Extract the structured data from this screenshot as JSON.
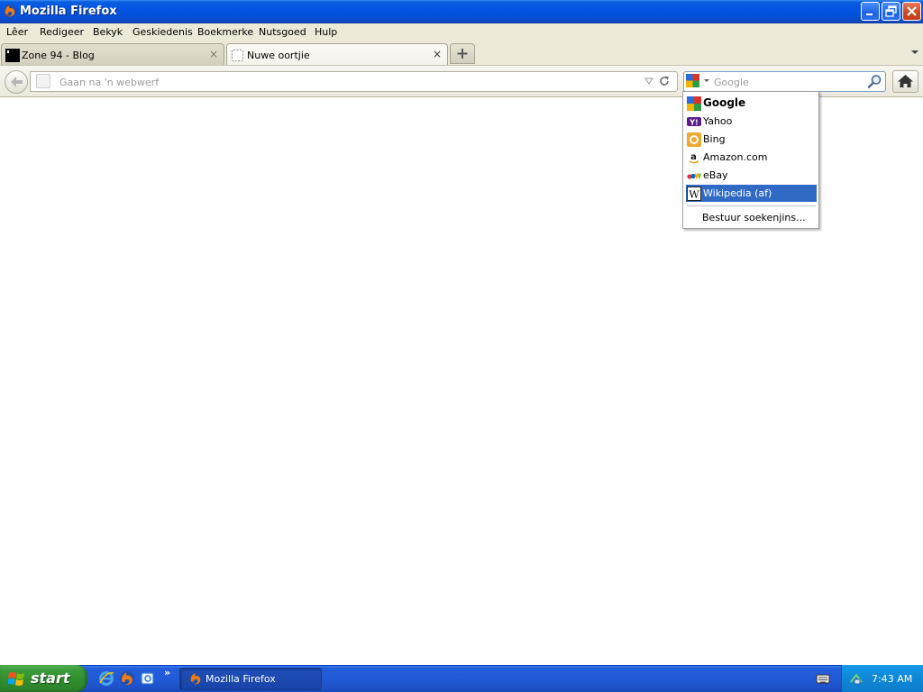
{
  "window": {
    "title": "Mozilla Firefox",
    "icon": "firefox-icon",
    "controls": [
      "minimize-icon",
      "restore-icon",
      "close-icon"
    ]
  },
  "menubar": {
    "items": [
      {
        "label": "Lêer"
      },
      {
        "label": "Redigeer"
      },
      {
        "label": "Bekyk"
      },
      {
        "label": "Geskiedenis"
      },
      {
        "label": "Boekmerke"
      },
      {
        "label": "Nutsgoed"
      },
      {
        "label": "Hulp"
      }
    ]
  },
  "tabs": [
    {
      "label": "Zone 94 - Blog",
      "favicon": "zone94-favicon",
      "active": false
    },
    {
      "label": "Nuwe oortjie",
      "favicon": "blank-page-icon",
      "active": true
    }
  ],
  "tab_close_glyph": "×",
  "navbar": {
    "url_placeholder": "Gaan na 'n webwerf",
    "url_value": "",
    "search_placeholder": "Google",
    "search_value": "",
    "current_engine": "google-icon"
  },
  "search_popup": {
    "engines": [
      {
        "label": "Google",
        "icon": "google-icon",
        "bold": true,
        "selected": false
      },
      {
        "label": "Yahoo",
        "icon": "yahoo-icon",
        "bold": false,
        "selected": false
      },
      {
        "label": "Bing",
        "icon": "bing-icon",
        "bold": false,
        "selected": false
      },
      {
        "label": "Amazon.com",
        "icon": "amazon-icon",
        "bold": false,
        "selected": false
      },
      {
        "label": "eBay",
        "icon": "ebay-icon",
        "bold": false,
        "selected": false
      },
      {
        "label": "Wikipedia (af)",
        "icon": "wikipedia-icon",
        "bold": false,
        "selected": true
      }
    ],
    "manage_label": "Bestuur soekenjins..."
  },
  "taskbar": {
    "start_label": "start",
    "quick_launch": [
      "internet-explorer-icon",
      "firefox-icon",
      "outlook-express-icon"
    ],
    "more_glyph": "»",
    "task_label": "Mozilla Firefox",
    "clock": "7:43 AM"
  },
  "colors": {
    "titlebar": "#0554e3",
    "selection": "#316ac5",
    "chrome": "#ece9d8",
    "taskbar": "#245edb",
    "start": "#3c9a3a"
  }
}
